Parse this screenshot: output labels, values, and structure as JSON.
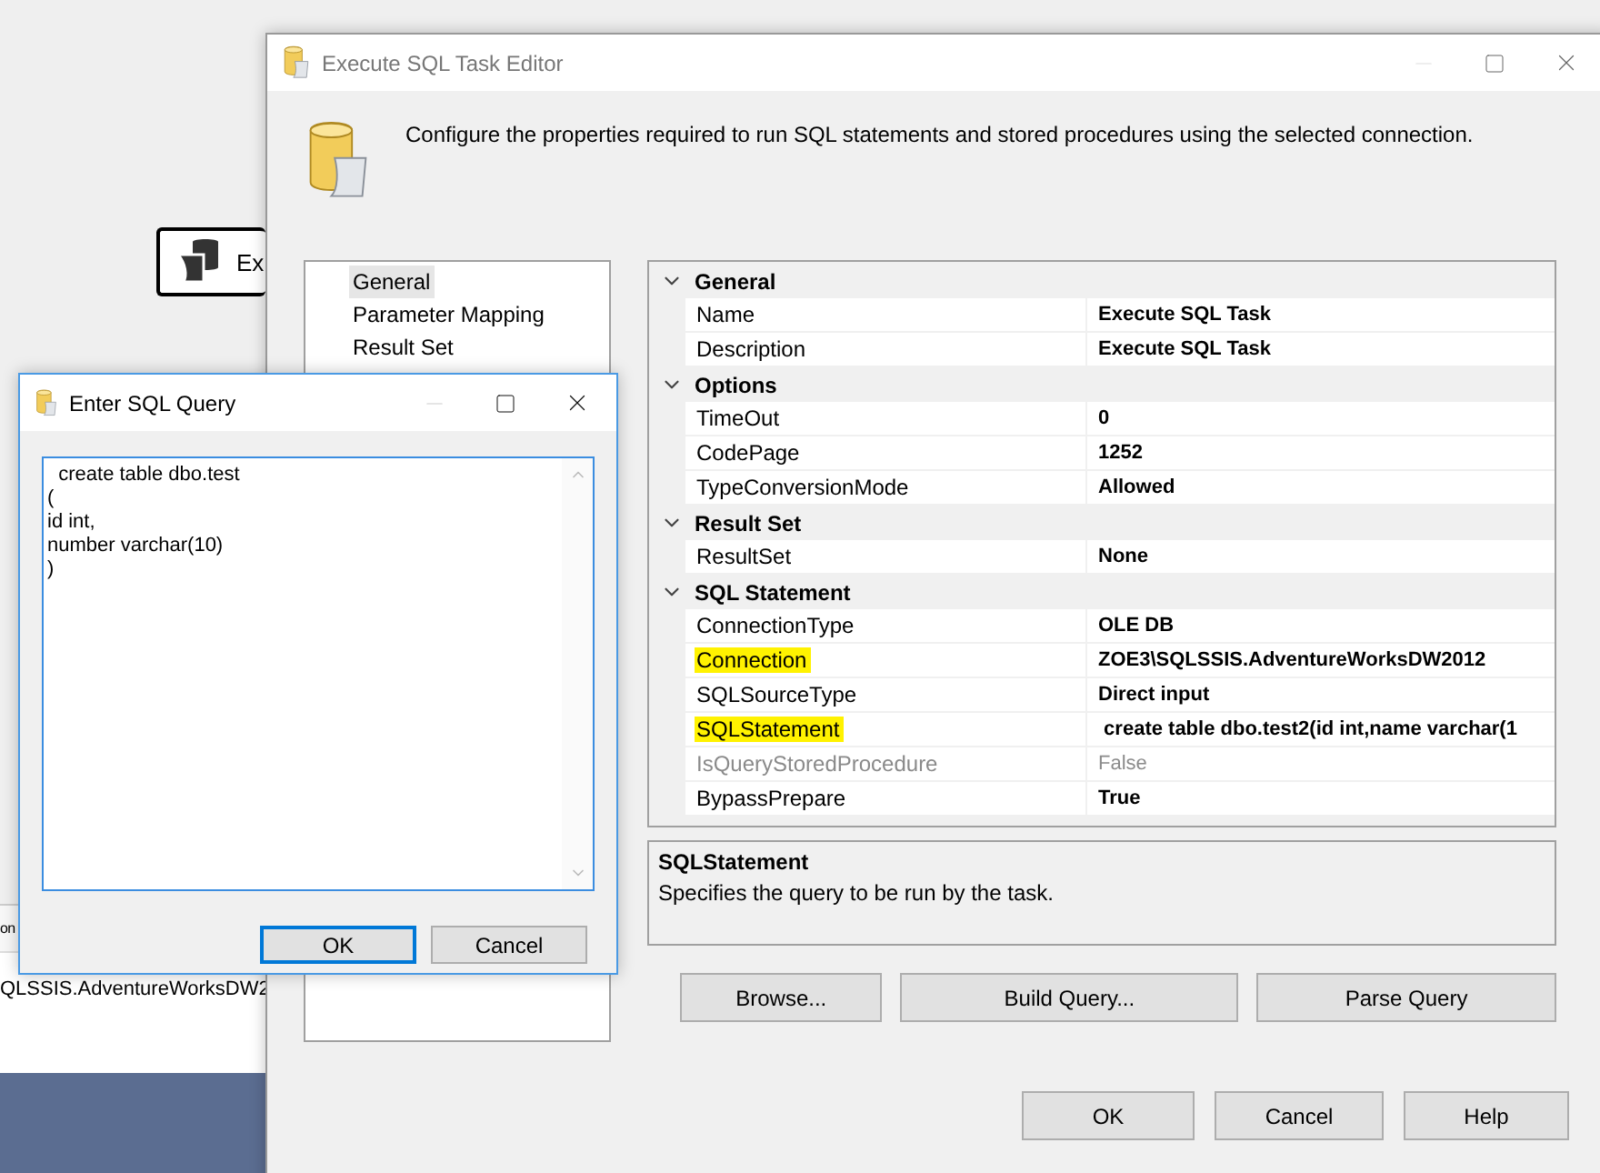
{
  "canvas": {
    "task_node": {
      "label": "Ex"
    },
    "panel": {
      "header": "on",
      "value": "QLSSIS.AdventureWorksDW2"
    }
  },
  "editor": {
    "title": "Execute SQL Task Editor",
    "description": "Configure the properties required to run SQL statements and stored procedures using the selected connection.",
    "nav": [
      {
        "label": "General",
        "selected": true
      },
      {
        "label": "Parameter Mapping",
        "selected": false
      },
      {
        "label": "Result Set",
        "selected": false
      }
    ],
    "categories": [
      {
        "name": "General",
        "expanded": true,
        "properties": [
          {
            "name": "Name",
            "value": "Execute SQL Task",
            "highlighted": false,
            "disabled": false
          },
          {
            "name": "Description",
            "value": "Execute SQL Task",
            "highlighted": false,
            "disabled": false
          }
        ]
      },
      {
        "name": "Options",
        "expanded": true,
        "properties": [
          {
            "name": "TimeOut",
            "value": "0",
            "highlighted": false,
            "disabled": false
          },
          {
            "name": "CodePage",
            "value": "1252",
            "highlighted": false,
            "disabled": false
          },
          {
            "name": "TypeConversionMode",
            "value": "Allowed",
            "highlighted": false,
            "disabled": false
          }
        ]
      },
      {
        "name": "Result Set",
        "expanded": true,
        "properties": [
          {
            "name": "ResultSet",
            "value": "None",
            "highlighted": false,
            "disabled": false
          }
        ]
      },
      {
        "name": "SQL Statement",
        "expanded": true,
        "properties": [
          {
            "name": "ConnectionType",
            "value": "OLE DB",
            "highlighted": false,
            "disabled": false
          },
          {
            "name": "Connection",
            "value": "ZOE3\\SQLSSIS.AdventureWorksDW2012",
            "highlighted": true,
            "disabled": false
          },
          {
            "name": "SQLSourceType",
            "value": "Direct input",
            "highlighted": false,
            "disabled": false
          },
          {
            "name": "SQLStatement",
            "value": " create table dbo.test2(id int,name varchar(1",
            "highlighted": true,
            "disabled": false
          },
          {
            "name": "IsQueryStoredProcedure",
            "value": "False",
            "highlighted": false,
            "disabled": true
          },
          {
            "name": "BypassPrepare",
            "value": "True",
            "highlighted": false,
            "disabled": false
          }
        ]
      }
    ],
    "help": {
      "title": "SQLStatement",
      "text": "Specifies the query to be run by the task."
    },
    "query_buttons": [
      "Browse...",
      "Build Query...",
      "Parse Query"
    ],
    "dialog_buttons": [
      "OK",
      "Cancel",
      "Help"
    ]
  },
  "query_dialog": {
    "title": "Enter SQL Query",
    "query": "  create table dbo.test\n(\nid int,\nnumber varchar(10)\n)",
    "buttons": [
      {
        "label": "OK",
        "default": true
      },
      {
        "label": "Cancel",
        "default": false
      }
    ]
  }
}
